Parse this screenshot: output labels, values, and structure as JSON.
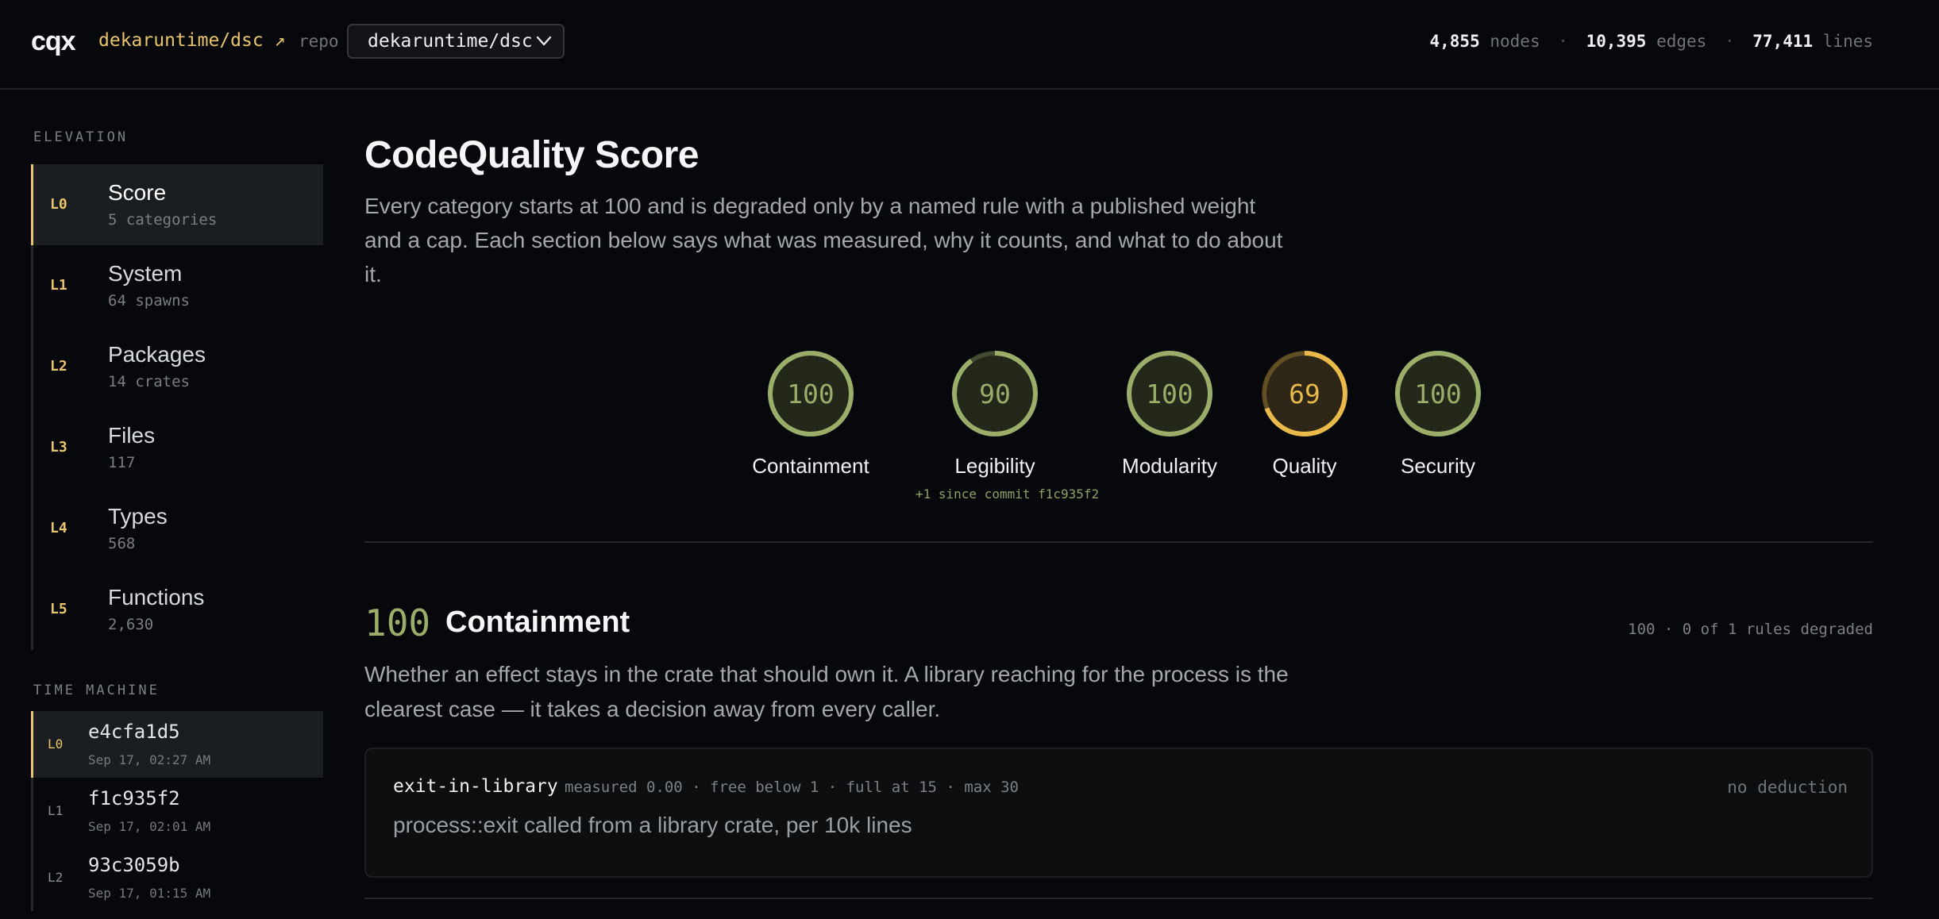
{
  "header": {
    "logo": "cqx",
    "repo_link": "dekaruntime/dsc ↗",
    "repo_label": "repo",
    "repo_selected": "dekaruntime/dsc",
    "stats": {
      "nodes_value": "4,855",
      "nodes_label": "nodes",
      "edges_value": "10,395",
      "edges_label": "edges",
      "lines_value": "77,411",
      "lines_label": "lines",
      "separator": "·"
    }
  },
  "sidebar": {
    "elevation_heading": "ELEVATION",
    "elevation": [
      {
        "level": "L0",
        "name": "Score",
        "sub": "5 categories"
      },
      {
        "level": "L1",
        "name": "System",
        "sub": "64 spawns"
      },
      {
        "level": "L2",
        "name": "Packages",
        "sub": "14 crates"
      },
      {
        "level": "L3",
        "name": "Files",
        "sub": "117"
      },
      {
        "level": "L4",
        "name": "Types",
        "sub": "568"
      },
      {
        "level": "L5",
        "name": "Functions",
        "sub": "2,630"
      }
    ],
    "time_machine_heading": "TIME MACHINE",
    "time_machine": [
      {
        "level": "L0",
        "hash": "e4cfa1d5",
        "time": "Sep 17, 02:27 AM"
      },
      {
        "level": "L1",
        "hash": "f1c935f2",
        "time": "Sep 17, 02:01 AM"
      },
      {
        "level": "L2",
        "hash": "93c3059b",
        "time": "Sep 17, 01:15 AM"
      }
    ]
  },
  "main": {
    "title": "CodeQuality Score",
    "description": "Every category starts at 100 and is degraded only by a named rule with a published weight and a cap. Each section below says what was measured, why it counts, and what to do about it.",
    "gauges": [
      {
        "score": 100,
        "label": "Containment",
        "note": "",
        "color": "#9aae6a"
      },
      {
        "score": 90,
        "label": "Legibility",
        "note": "+1 since commit f1c935f2",
        "color": "#9aae6a"
      },
      {
        "score": 100,
        "label": "Modularity",
        "note": "",
        "color": "#9aae6a"
      },
      {
        "score": 69,
        "label": "Quality",
        "note": "",
        "color": "#e9b949"
      },
      {
        "score": 100,
        "label": "Security",
        "note": "",
        "color": "#9aae6a"
      }
    ],
    "section": {
      "score": "100",
      "title": "Containment",
      "meta": "100 · 0 of 1 rules degraded",
      "description": "Whether an effect stays in the crate that should own it. A library reaching for the process is the clearest case — it takes a decision away from every caller.",
      "rule": {
        "name": "exit-in-library",
        "params": "measured 0.00 · free below 1 · full at 15 · max 30",
        "status": "no deduction",
        "description": "process::exit called from a library crate, per 10k lines"
      }
    }
  }
}
